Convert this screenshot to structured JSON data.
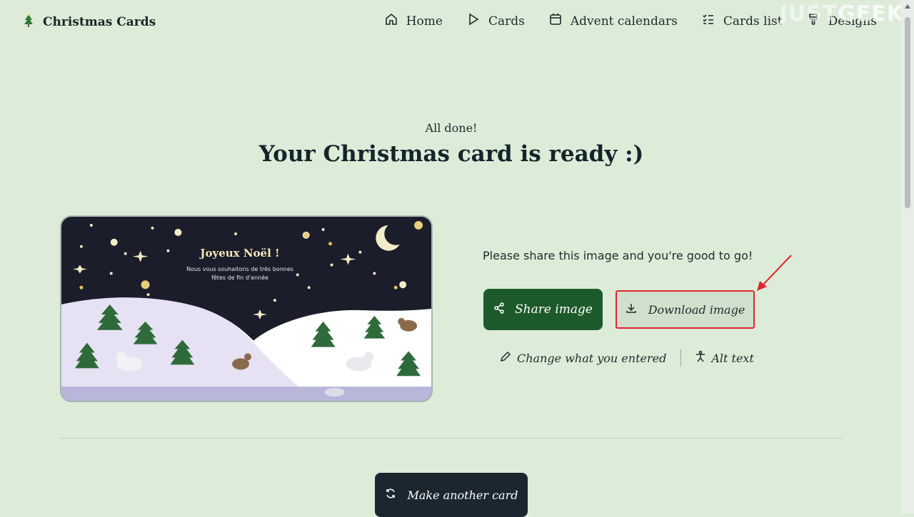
{
  "header": {
    "brand": "Christmas Cards",
    "nav": [
      {
        "label": "Home",
        "icon": "home-icon"
      },
      {
        "label": "Cards",
        "icon": "play-icon"
      },
      {
        "label": "Advent calendars",
        "icon": "calendar-icon"
      },
      {
        "label": "Cards list",
        "icon": "checklist-icon"
      },
      {
        "label": "Designs",
        "icon": "brush-icon"
      }
    ],
    "watermark": {
      "part1": "JUST",
      "part2": "GEEK"
    }
  },
  "hero": {
    "kicker": "All done!",
    "title": "Your Christmas card is ready :)"
  },
  "card_preview": {
    "greeting": "Joyeux Noël !",
    "message": "Nous vous souhaitons de très bonnes fêtes de fin d'année"
  },
  "actions": {
    "share_message": "Please share this image and you're good to go!",
    "share_label": "Share image",
    "download_label": "Download image",
    "change_label": "Change what you entered",
    "alt_text_label": "Alt text",
    "make_another_label": "Make another card"
  },
  "colors": {
    "background": "#dcecd9",
    "share_button": "#1d5a2b",
    "make_another_button": "#1b2730",
    "highlight": "#e0252c"
  }
}
